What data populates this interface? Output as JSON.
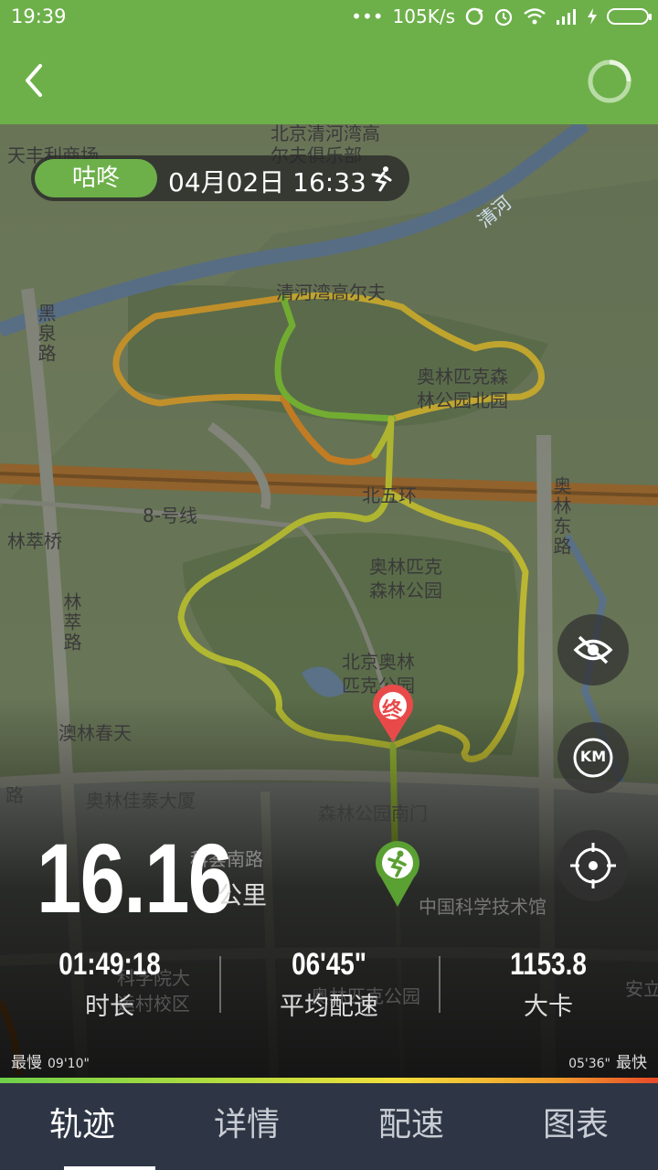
{
  "status_bar": {
    "time": "19:39",
    "dots": "•••",
    "net_speed": "105K/s"
  },
  "header": {
    "back_icon": "chevron-left-icon",
    "refresh_icon": "loading-ring-icon"
  },
  "record": {
    "brand": "咕咚",
    "datetime": "04月02日 16:33",
    "sport_icon": "running-icon"
  },
  "map_labels": {
    "tianfeng": "天丰利商场",
    "golf_club_1": "北京清河湾高",
    "golf_club_2": "尔夫俱乐部",
    "qinghe_river": "清河",
    "golf_1": "清河湾高尔夫",
    "heiquan_road": "黑泉路",
    "olympic_north_1": "奥林匹克森",
    "olympic_north_2": "林公园北园",
    "north_5th_ring": "北五环",
    "line8": "8-号线",
    "lincuiqiao": "林萃桥",
    "aolin_east_road": "奥林东路",
    "olympic_forest_1": "奥林匹克",
    "olympic_forest_2": "森林公园",
    "lincui_road": "林萃路",
    "bj_olympic_1": "北京奥林",
    "bj_olympic_2": "匹克公园",
    "aolin_chuntian": "澳林春天",
    "aolin_jiatai": "奥林佳泰大厦",
    "road_fragment": "路",
    "forest_south_gate": "森林公园南门",
    "kehui_south_road": "科荟南路",
    "sci_museum": "中国科学技术馆",
    "kexueyuan": "科学院大",
    "yundong_school": "运村校区",
    "olympic_park_station": "奥林匹克公园",
    "anli": "安立",
    "end_marker": "终"
  },
  "controls": {
    "hide_icon": "eye-off-icon",
    "unit_label": "KM",
    "locate_icon": "crosshair-icon"
  },
  "stats": {
    "distance": "16.16",
    "distance_unit": "公里",
    "duration": "01:49:18",
    "duration_label": "时长",
    "avg_pace": "06'45\"",
    "avg_pace_label": "平均配速",
    "calories": "1153.8",
    "calories_label": "大卡"
  },
  "pace_legend": {
    "slow_label": "最慢",
    "slow_value": "09'10\"",
    "fast_value": "05'36\"",
    "fast_label": "最快"
  },
  "tabs": [
    {
      "label": "轨迹",
      "active": true
    },
    {
      "label": "详情",
      "active": false
    },
    {
      "label": "配速",
      "active": false
    },
    {
      "label": "图表",
      "active": false
    }
  ],
  "colors": {
    "accent": "#6db04a",
    "tab_bar": "#2e3645",
    "route_fast": "#6fd04a",
    "route_mid": "#f2df3c",
    "route_slow": "#f29a2c",
    "end_marker": "#e84a4a"
  }
}
